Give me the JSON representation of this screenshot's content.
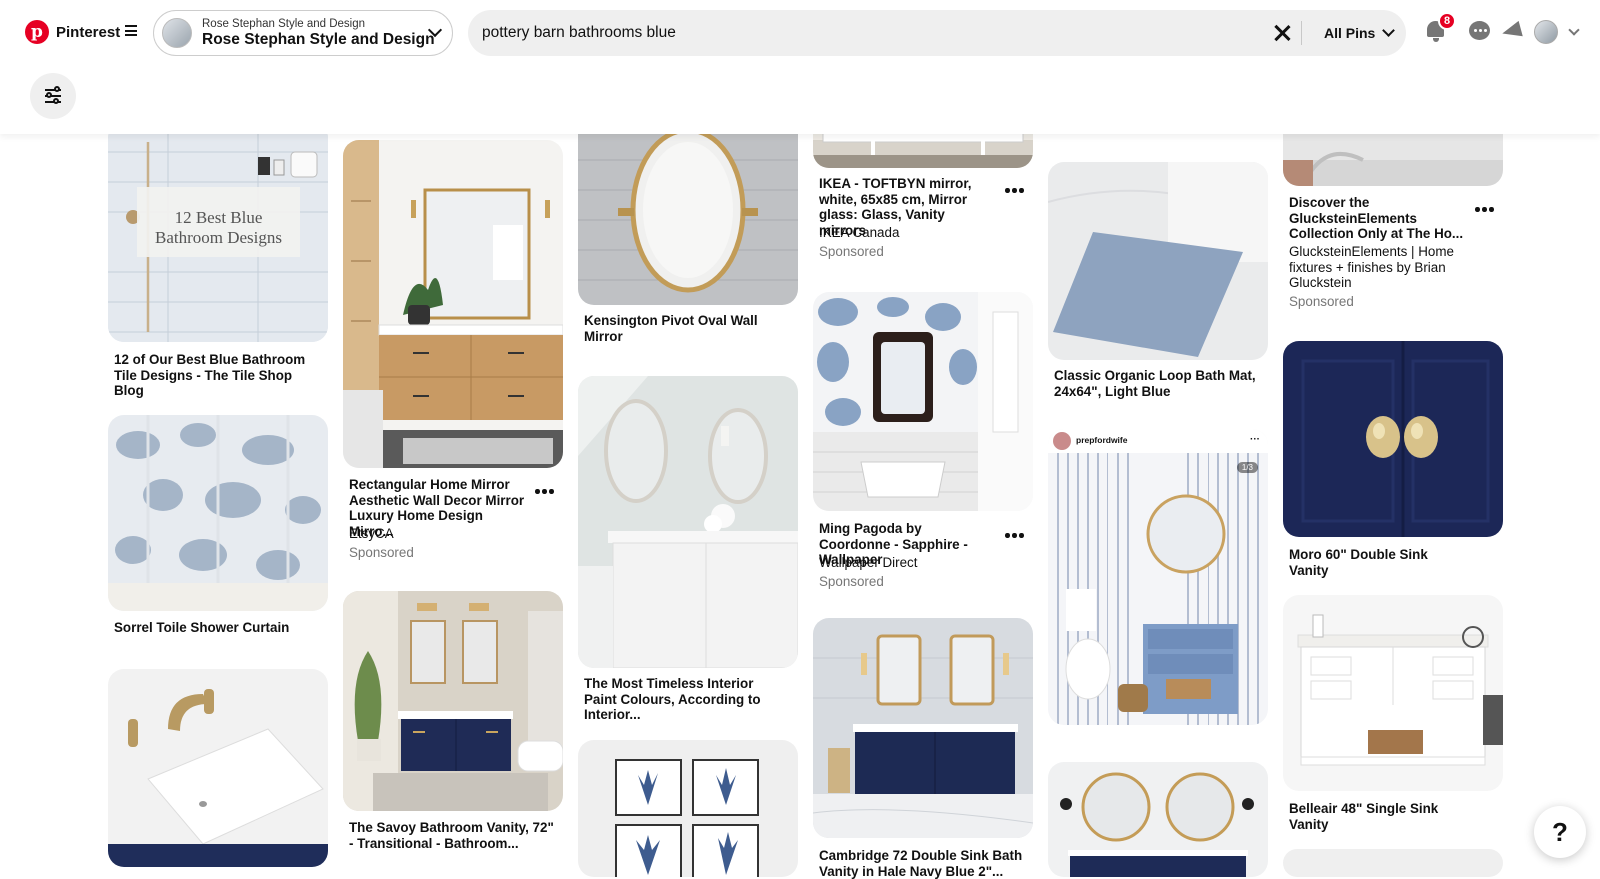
{
  "header": {
    "logo_text": "Pinterest",
    "account": {
      "subtitle": "Rose Stephan Style and Design",
      "name": "Rose Stephan Style and Design"
    },
    "search": {
      "value": "pottery barn bathrooms blue",
      "filter_label": "All Pins"
    },
    "notification_count": "8",
    "brand_color": "#e60023"
  },
  "help_label": "?",
  "pins": [
    {
      "title": "12 of Our Best Blue Bathroom Tile Designs - The Tile Shop Blog",
      "overlay_line1": "12 Best Blue",
      "overlay_line2": "Bathroom Designs"
    },
    {
      "title": "Sorrel Toile Shower Curtain"
    },
    {
      "title": "Rectangular Home Mirror Aesthetic Wall Decor Mirror Luxury Home Design Mirro...",
      "source": "EtsyCA",
      "sponsored": "Sponsored"
    },
    {
      "title": "The Savoy Bathroom Vanity, 72\" - Transitional - Bathroom..."
    },
    {
      "title": "Kensington Pivot Oval Wall Mirror"
    },
    {
      "title": "The Most Timeless Interior Paint Colours, According to Interior..."
    },
    {
      "title": "IKEA - TOFTBYN mirror, white, 65x85 cm, Mirror glass: Glass, Vanity mirrors",
      "source": "IKEA Canada",
      "sponsored": "Sponsored"
    },
    {
      "title": "Ming Pagoda by Coordonne - Sapphire - Wallpaper",
      "source": "Wallpaper Direct",
      "sponsored": "Sponsored"
    },
    {
      "title": "Cambridge 72 Double Sink Bath Vanity in Hale Navy Blue 2\"..."
    },
    {
      "title": "Classic Organic Loop Bath Mat, 24x64\", Light Blue"
    },
    {
      "creator": "prepfordwife",
      "counter": "1/3"
    },
    {
      "title": "Discover the GlucksteinElements Collection Only at The Ho...",
      "source": "GlucksteinElements | Home fixtures + finishes by Brian Gluckstein",
      "sponsored": "Sponsored"
    },
    {
      "title": "Moro 60\" Double Sink Vanity"
    },
    {
      "title": "Belleair 48\" Single Sink Vanity"
    }
  ]
}
